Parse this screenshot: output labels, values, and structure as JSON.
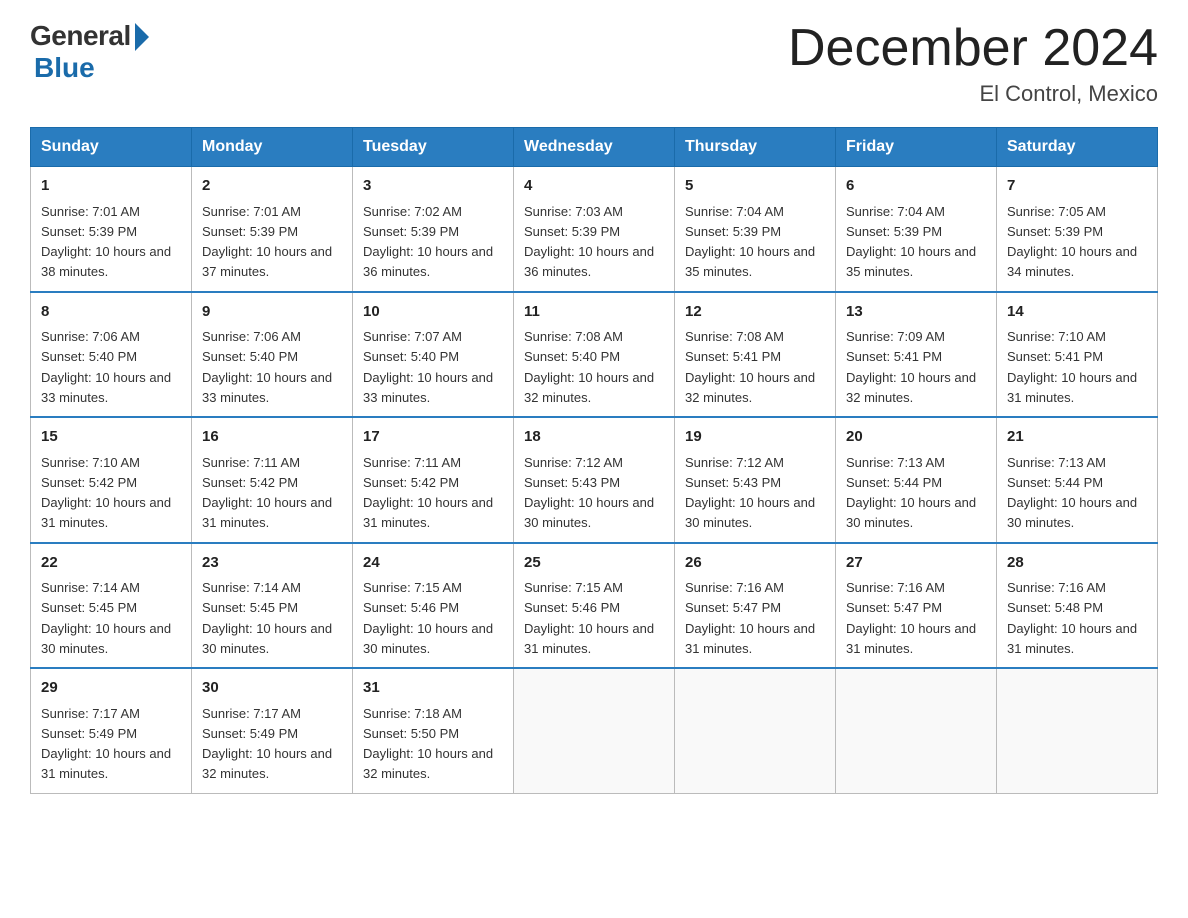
{
  "logo": {
    "general": "General",
    "blue": "Blue"
  },
  "title": "December 2024",
  "location": "El Control, Mexico",
  "days_of_week": [
    "Sunday",
    "Monday",
    "Tuesday",
    "Wednesday",
    "Thursday",
    "Friday",
    "Saturday"
  ],
  "weeks": [
    [
      {
        "day": "1",
        "sunrise": "7:01 AM",
        "sunset": "5:39 PM",
        "daylight": "10 hours and 38 minutes."
      },
      {
        "day": "2",
        "sunrise": "7:01 AM",
        "sunset": "5:39 PM",
        "daylight": "10 hours and 37 minutes."
      },
      {
        "day": "3",
        "sunrise": "7:02 AM",
        "sunset": "5:39 PM",
        "daylight": "10 hours and 36 minutes."
      },
      {
        "day": "4",
        "sunrise": "7:03 AM",
        "sunset": "5:39 PM",
        "daylight": "10 hours and 36 minutes."
      },
      {
        "day": "5",
        "sunrise": "7:04 AM",
        "sunset": "5:39 PM",
        "daylight": "10 hours and 35 minutes."
      },
      {
        "day": "6",
        "sunrise": "7:04 AM",
        "sunset": "5:39 PM",
        "daylight": "10 hours and 35 minutes."
      },
      {
        "day": "7",
        "sunrise": "7:05 AM",
        "sunset": "5:39 PM",
        "daylight": "10 hours and 34 minutes."
      }
    ],
    [
      {
        "day": "8",
        "sunrise": "7:06 AM",
        "sunset": "5:40 PM",
        "daylight": "10 hours and 33 minutes."
      },
      {
        "day": "9",
        "sunrise": "7:06 AM",
        "sunset": "5:40 PM",
        "daylight": "10 hours and 33 minutes."
      },
      {
        "day": "10",
        "sunrise": "7:07 AM",
        "sunset": "5:40 PM",
        "daylight": "10 hours and 33 minutes."
      },
      {
        "day": "11",
        "sunrise": "7:08 AM",
        "sunset": "5:40 PM",
        "daylight": "10 hours and 32 minutes."
      },
      {
        "day": "12",
        "sunrise": "7:08 AM",
        "sunset": "5:41 PM",
        "daylight": "10 hours and 32 minutes."
      },
      {
        "day": "13",
        "sunrise": "7:09 AM",
        "sunset": "5:41 PM",
        "daylight": "10 hours and 32 minutes."
      },
      {
        "day": "14",
        "sunrise": "7:10 AM",
        "sunset": "5:41 PM",
        "daylight": "10 hours and 31 minutes."
      }
    ],
    [
      {
        "day": "15",
        "sunrise": "7:10 AM",
        "sunset": "5:42 PM",
        "daylight": "10 hours and 31 minutes."
      },
      {
        "day": "16",
        "sunrise": "7:11 AM",
        "sunset": "5:42 PM",
        "daylight": "10 hours and 31 minutes."
      },
      {
        "day": "17",
        "sunrise": "7:11 AM",
        "sunset": "5:42 PM",
        "daylight": "10 hours and 31 minutes."
      },
      {
        "day": "18",
        "sunrise": "7:12 AM",
        "sunset": "5:43 PM",
        "daylight": "10 hours and 30 minutes."
      },
      {
        "day": "19",
        "sunrise": "7:12 AM",
        "sunset": "5:43 PM",
        "daylight": "10 hours and 30 minutes."
      },
      {
        "day": "20",
        "sunrise": "7:13 AM",
        "sunset": "5:44 PM",
        "daylight": "10 hours and 30 minutes."
      },
      {
        "day": "21",
        "sunrise": "7:13 AM",
        "sunset": "5:44 PM",
        "daylight": "10 hours and 30 minutes."
      }
    ],
    [
      {
        "day": "22",
        "sunrise": "7:14 AM",
        "sunset": "5:45 PM",
        "daylight": "10 hours and 30 minutes."
      },
      {
        "day": "23",
        "sunrise": "7:14 AM",
        "sunset": "5:45 PM",
        "daylight": "10 hours and 30 minutes."
      },
      {
        "day": "24",
        "sunrise": "7:15 AM",
        "sunset": "5:46 PM",
        "daylight": "10 hours and 30 minutes."
      },
      {
        "day": "25",
        "sunrise": "7:15 AM",
        "sunset": "5:46 PM",
        "daylight": "10 hours and 31 minutes."
      },
      {
        "day": "26",
        "sunrise": "7:16 AM",
        "sunset": "5:47 PM",
        "daylight": "10 hours and 31 minutes."
      },
      {
        "day": "27",
        "sunrise": "7:16 AM",
        "sunset": "5:47 PM",
        "daylight": "10 hours and 31 minutes."
      },
      {
        "day": "28",
        "sunrise": "7:16 AM",
        "sunset": "5:48 PM",
        "daylight": "10 hours and 31 minutes."
      }
    ],
    [
      {
        "day": "29",
        "sunrise": "7:17 AM",
        "sunset": "5:49 PM",
        "daylight": "10 hours and 31 minutes."
      },
      {
        "day": "30",
        "sunrise": "7:17 AM",
        "sunset": "5:49 PM",
        "daylight": "10 hours and 32 minutes."
      },
      {
        "day": "31",
        "sunrise": "7:18 AM",
        "sunset": "5:50 PM",
        "daylight": "10 hours and 32 minutes."
      },
      null,
      null,
      null,
      null
    ]
  ]
}
